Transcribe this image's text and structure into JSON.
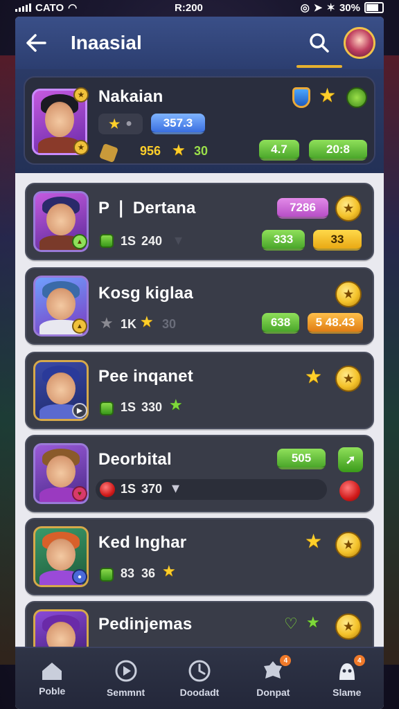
{
  "status_bar": {
    "carrier": "CATO",
    "time": "R:200",
    "battery": "30%"
  },
  "header": {
    "title": "Inaasial"
  },
  "featured": {
    "name": "Nakaian",
    "tag_value": "357.3",
    "stat_primary": "956",
    "stat_secondary": "30",
    "pill_left": "4.7",
    "pill_right": "20:8"
  },
  "players": [
    {
      "name": "P ❘ Dertana",
      "stat_a": "1S",
      "stat_b": "240",
      "pill_top": "7286",
      "pill_bottom_left": "333",
      "pill_bottom_right": "33"
    },
    {
      "name": "Kosg kiglaa",
      "stat_a": "1K",
      "stat_b": "30",
      "pill_left": "638",
      "pill_right": "5 48.43"
    },
    {
      "name": "Pee inqanet",
      "stat_a": "1S",
      "stat_b": "330"
    },
    {
      "name": "Deorbital",
      "stat_a": "1S",
      "stat_b": "370",
      "pill": "505"
    },
    {
      "name": "Ked Inghar",
      "stat_a": "83",
      "stat_b": "36"
    },
    {
      "name": "Pedinjemas"
    }
  ],
  "bottom_nav": [
    {
      "label": "Poble",
      "icon": "home-icon"
    },
    {
      "label": "Semmnt",
      "icon": "play-icon"
    },
    {
      "label": "Doodadt",
      "icon": "clock-icon"
    },
    {
      "label": "Donpat",
      "icon": "badge-icon",
      "badge": "4"
    },
    {
      "label": "Slame",
      "icon": "character-icon",
      "badge": "4"
    }
  ],
  "colors": {
    "header_bg": "#2c3e70",
    "card_bg": "#393c48",
    "accent_gold": "#e6b12f",
    "accent_green": "#4aa62a"
  }
}
